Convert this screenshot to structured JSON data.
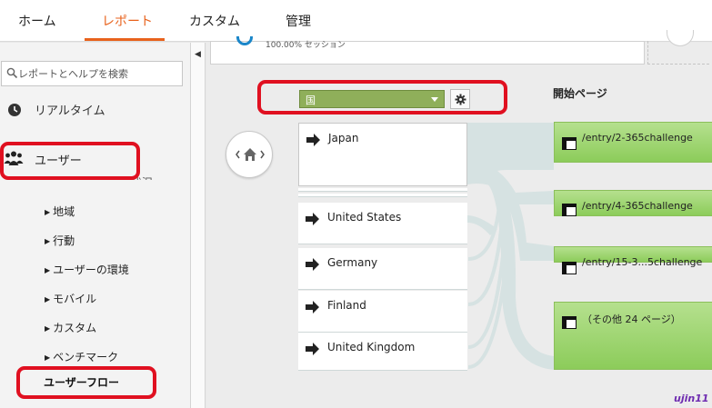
{
  "nav": {
    "items": [
      {
        "label": "ホーム"
      },
      {
        "label": "レポート"
      },
      {
        "label": "カスタム"
      },
      {
        "label": "管理"
      }
    ],
    "active_index": 1,
    "accent_color": "#e8621c"
  },
  "sidebar": {
    "search_placeholder": "レポートとヘルプを検索",
    "realtime": "リアルタイム",
    "users": "ユーザー",
    "cutoff_text": "ユーザーの分布状況",
    "sub_items": [
      "地域",
      "行動",
      "ユーザーの環境",
      "モバイル",
      "カスタム",
      "ベンチマーク"
    ],
    "user_flow": "ユーザーフロー",
    "icons": [
      "search-icon",
      "clock-icon",
      "users-icon",
      "triangle-right-icon"
    ]
  },
  "main": {
    "top_card_text": "100.00% セッション",
    "dimension_selector": "国",
    "start_page_header": "開始ページ",
    "countries": [
      "Japan",
      "United States",
      "Germany",
      "Finland",
      "United Kingdom"
    ],
    "start_pages": [
      "/entry/2-365challenge",
      "/entry/4-365challenge",
      "/entry/15-3...5challenge",
      "（その他 24 ページ）"
    ],
    "node_color": "#8ccc5a",
    "flow_color": "#d6e2e2",
    "icons": [
      "home-icon",
      "gear-icon",
      "enter-arrow-icon",
      "page-layout-icon"
    ]
  },
  "annotation_color": "#e01020",
  "watermark": "ujin11"
}
